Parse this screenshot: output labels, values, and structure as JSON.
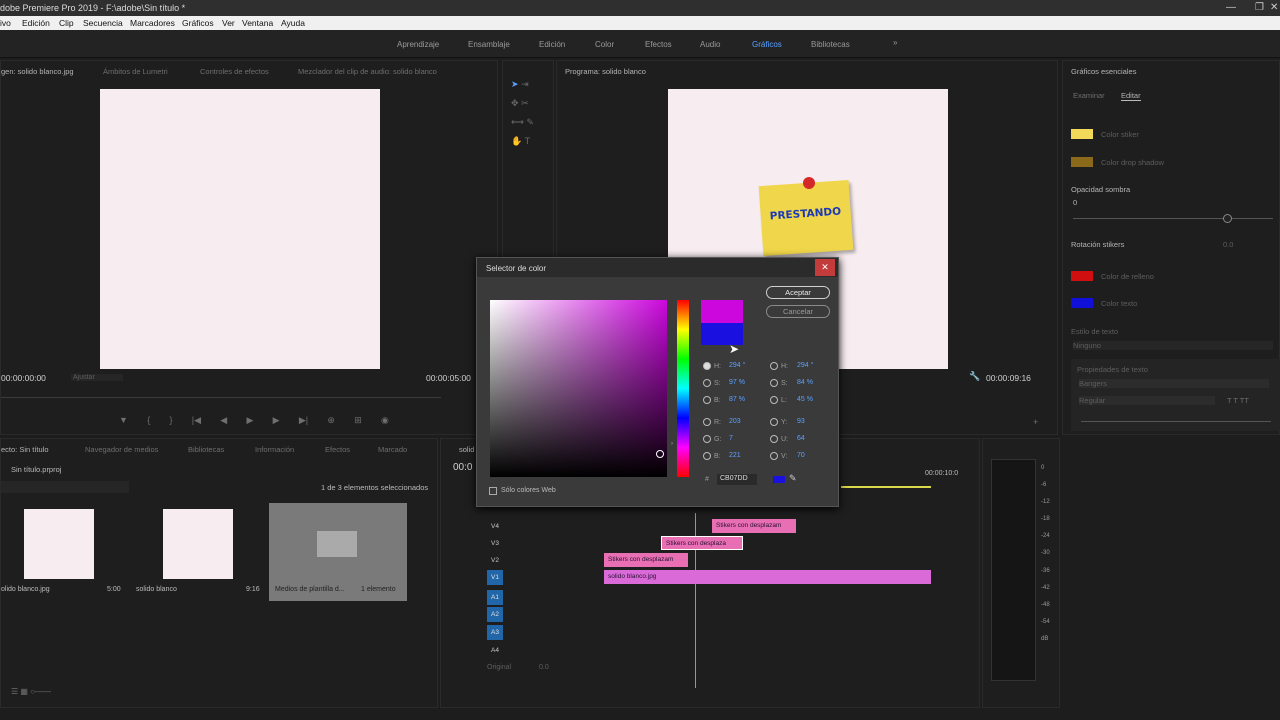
{
  "titlebar": {
    "title": "dobe Premiere Pro 2019 - F:\\adobe\\Sin título *"
  },
  "menu": [
    "ivo",
    "Edición",
    "Clip",
    "Secuencia",
    "Marcadores",
    "Gráficos",
    "Ver",
    "Ventana",
    "Ayuda"
  ],
  "workspaces": [
    "Aprendizaje",
    "Ensamblaje",
    "Edición",
    "Color",
    "Efectos",
    "Audio",
    "Gráficos",
    "Bibliotecas"
  ],
  "source_panel": {
    "tabs": [
      "gen: solido blanco.jpg",
      "Ámbitos de Lumetri",
      "Controles de efectos",
      "Mezclador del clip de audio: solido blanco"
    ],
    "timecode_in": "00:00:00:00",
    "fit": "Ajustar",
    "timecode_out": "00:00:05:00"
  },
  "program_panel": {
    "tab": "Programa: solido blanco",
    "timecode_out": "00:00:09:16",
    "sticker_text": "PRESTANDO"
  },
  "project_panel": {
    "tabs": [
      "ecto: Sin título",
      "Navegador de medios",
      "Bibliotecas",
      "Información",
      "Efectos",
      "Marcado"
    ],
    "project_name": "Sin título.prproj",
    "selection_text": "1 de 3 elementos seleccionados",
    "items": [
      {
        "name": "olido blanco.jpg",
        "duration": "5:00"
      },
      {
        "name": "solido blanco",
        "duration": "9:16"
      },
      {
        "name": "Medios de plantilla d...",
        "duration": "1 elemento"
      }
    ]
  },
  "timeline": {
    "tab": "solid",
    "timecode": "00:0",
    "ruler_end": "00:00:10:0",
    "tracks": [
      "V4",
      "V3",
      "V2",
      "V1",
      "A1",
      "A2",
      "A3",
      "A4"
    ],
    "master": "Original",
    "master_value": "0.0",
    "clips": [
      {
        "label": "Stikers con desplazam"
      },
      {
        "label": "Stikers con desplaza"
      },
      {
        "label": "Stikers con desplazam"
      },
      {
        "label": "solido blanco.jpg"
      }
    ]
  },
  "audio_meter": {
    "ticks": [
      "0",
      "-6",
      "-12",
      "-18",
      "-24",
      "-30",
      "-36",
      "-42",
      "-48",
      "-54",
      "dB"
    ]
  },
  "essential_graphics": {
    "title": "Gráficos esenciales",
    "tabs": [
      "Examinar",
      "Editar"
    ],
    "layers": [
      "Color stiker",
      "Color drop shadow"
    ],
    "shadow_label": "Opacidad sombra",
    "shadow_value": "0",
    "rotation_label": "Rotación stikers",
    "rotation_value": "0.0",
    "color_layers": [
      "Color de relleno",
      "Color texto"
    ],
    "text_style": "Estilo de texto",
    "text_style_value": "Ninguno",
    "text_props": "Propiedades de texto",
    "font": "Bangers",
    "font_style": "Regular"
  },
  "color_picker": {
    "title": "Selector de color",
    "ok": "Aceptar",
    "cancel": "Cancelar",
    "web_only": "Sólo colores Web",
    "hex": "CB07DD",
    "hex_label": "#",
    "hsb": [
      {
        "k": "H:",
        "v": "294 °"
      },
      {
        "k": "S:",
        "v": "97 %"
      },
      {
        "k": "B:",
        "v": "87 %"
      }
    ],
    "hsl": [
      {
        "k": "H:",
        "v": "294 °"
      },
      {
        "k": "S:",
        "v": "84 %"
      },
      {
        "k": "L:",
        "v": "45 %"
      }
    ],
    "rgb": [
      {
        "k": "R:",
        "v": "203"
      },
      {
        "k": "G:",
        "v": "7"
      },
      {
        "k": "B:",
        "v": "221"
      }
    ],
    "yuv": [
      {
        "k": "Y:",
        "v": "93"
      },
      {
        "k": "U:",
        "v": "64"
      },
      {
        "k": "V:",
        "v": "70"
      }
    ],
    "new_color": "#cb07dd",
    "old_color": "#1a10e0"
  },
  "colors": {
    "accent": "#5aa0ff",
    "clip_pink": "#e86fb3",
    "clip_magenta": "#d96ad8",
    "swatch_yellow": "#f3d95a",
    "swatch_brown": "#8a6a1a",
    "swatch_red": "#d01010",
    "swatch_blue": "#1010d8"
  }
}
